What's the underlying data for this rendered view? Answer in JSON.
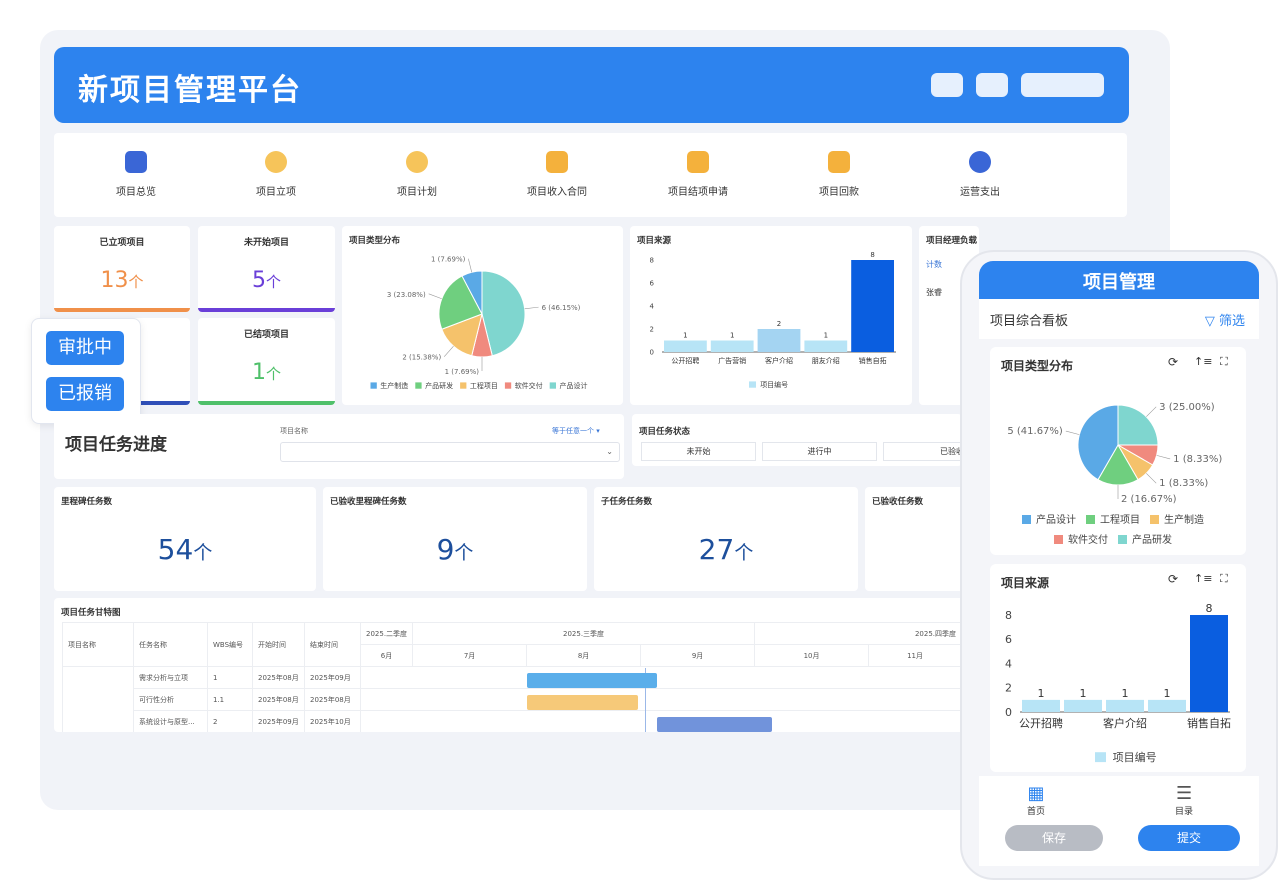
{
  "app": {
    "title": "新项目管理平台"
  },
  "nav": [
    {
      "label": "项目总览",
      "color": "#3a66d6"
    },
    {
      "label": "项目立项",
      "color": "#f4b13c"
    },
    {
      "label": "项目计划",
      "color": "#f4b13c"
    },
    {
      "label": "项目收入合同",
      "color": "#f4b13c"
    },
    {
      "label": "项目结项申请",
      "color": "#f4b13c"
    },
    {
      "label": "项目回款",
      "color": "#f4b13c"
    },
    {
      "label": "运营支出",
      "color": "#3a66d6"
    }
  ],
  "stats": [
    {
      "label": "已立项项目",
      "value": "13",
      "unit": "个",
      "color": "#f0904a"
    },
    {
      "label": "未开始项目",
      "value": "5",
      "unit": "个",
      "color": "#6a3fd8"
    },
    {
      "label": "已结项项目",
      "value": "1",
      "unit": "个",
      "color": "#4fc06a"
    }
  ],
  "tags": [
    "审批中",
    "已报销"
  ],
  "manager": {
    "title": "项目经理负载",
    "col": "计数",
    "row": "张睿"
  },
  "progress": {
    "title": "项目任务进度",
    "filter_label": "项目名称",
    "filter_mode": "等于任意一个",
    "status_title": "项目任务状态",
    "status_options": [
      "未开始",
      "进行中",
      "已验收"
    ]
  },
  "counts": [
    {
      "label": "里程碑任务数",
      "value": "54",
      "unit": "个"
    },
    {
      "label": "已验收里程碑任务数",
      "value": "9",
      "unit": "个"
    },
    {
      "label": "子任务任务数",
      "value": "27",
      "unit": "个"
    },
    {
      "label": "已验收任务数"
    }
  ],
  "gantt": {
    "title": "项目任务甘特图",
    "columns": [
      "项目名称",
      "任务名称",
      "WBS编号",
      "开始时间",
      "结束时间"
    ],
    "quarters": [
      "2025.二季度",
      "2025.三季度",
      "2025.四季度"
    ],
    "months": [
      "6月",
      "7月",
      "8月",
      "9月",
      "10月",
      "11月"
    ],
    "rows": [
      {
        "name": "需求分析与立项",
        "wbs": "1",
        "start": "2025年08月",
        "end": "2025年09月",
        "color": "#5aaeea"
      },
      {
        "name": "可行性分析",
        "wbs": "1.1",
        "start": "2025年08月",
        "end": "2025年08月",
        "color": "#f6c979"
      },
      {
        "name": "系统设计与原型...",
        "wbs": "2",
        "start": "2025年09月",
        "end": "2025年10月",
        "color": "#7193db"
      }
    ]
  },
  "mobile": {
    "title": "项目管理",
    "board": "项目综合看板",
    "filter": "筛选",
    "tabs": [
      "首页",
      "目录"
    ],
    "save": "保存",
    "submit": "提交"
  },
  "chart_data": [
    {
      "type": "pie",
      "title": "项目类型分布",
      "labels": [
        "产品设计",
        "软件交付",
        "工程项目",
        "产品研发",
        "生产制造"
      ],
      "values": [
        6,
        1,
        2,
        3,
        1
      ],
      "value_labels": [
        "6 (46.15%)",
        "1 (7.69%)",
        "2 (15.38%)",
        "3 (23.08%)",
        "1 (7.69%)"
      ],
      "colors": [
        "#7fd6cf",
        "#f08a7e",
        "#f5c26b",
        "#6fcf7f",
        "#5aa9e6"
      ],
      "legend": [
        "生产制造",
        "产品研发",
        "工程项目",
        "软件交付",
        "产品设计"
      ],
      "legend_colors": [
        "#5aa9e6",
        "#6fcf7f",
        "#f5c26b",
        "#f08a7e",
        "#7fd6cf"
      ]
    },
    {
      "type": "bar",
      "title": "项目来源",
      "categories": [
        "公开招聘",
        "广告营销",
        "客户介绍",
        "朋友介绍",
        "销售自拓"
      ],
      "values": [
        1,
        1,
        2,
        1,
        8
      ],
      "ylim": [
        0,
        8
      ],
      "yticks": [
        "0",
        "2",
        "4",
        "6",
        "8"
      ],
      "legend": "项目编号"
    },
    {
      "type": "pie",
      "title": "项目类型分布",
      "labels": [
        "产品研发",
        "软件交付",
        "生产制造",
        "工程项目",
        "产品设计"
      ],
      "values": [
        3,
        1,
        1,
        2,
        5
      ],
      "value_labels": [
        "3 (25.00%)",
        "1 (8.33%)",
        "1 (8.33%)",
        "2 (16.67%)",
        "5 (41.67%)"
      ],
      "colors": [
        "#7fd6cf",
        "#f08a7e",
        "#f5c26b",
        "#6fcf7f",
        "#5aa9e6"
      ],
      "legend": [
        "产品设计",
        "工程项目",
        "生产制造",
        "软件交付",
        "产品研发"
      ],
      "legend_colors": [
        "#5aa9e6",
        "#6fcf7f",
        "#f5c26b",
        "#f08a7e",
        "#7fd6cf"
      ]
    },
    {
      "type": "bar",
      "title": "项目来源",
      "categories": [
        "公开招聘",
        "广告营销",
        "客户介绍",
        "朋友介绍",
        "销售自拓"
      ],
      "tick_labels": [
        "公开招聘",
        "",
        "客户介绍",
        "",
        "销售自拓"
      ],
      "values": [
        1,
        1,
        1,
        1,
        8
      ],
      "ylim": [
        0,
        8
      ],
      "yticks": [
        "0",
        "2",
        "4",
        "6",
        "8"
      ],
      "legend": "项目编号"
    }
  ]
}
